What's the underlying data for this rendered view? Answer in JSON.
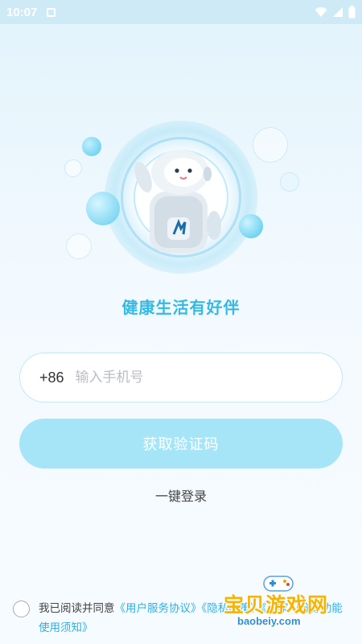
{
  "status_bar": {
    "time": "10:07",
    "icons": [
      "notification-icon",
      "wifi-icon",
      "signal-icon",
      "battery-icon"
    ]
  },
  "login": {
    "slogan": "健康生活有好伴",
    "country_code": "+86",
    "phone_placeholder": "输入手机号",
    "get_code_label": "获取验证码",
    "one_click_label": "一键登录"
  },
  "agreement": {
    "prefix": "我已阅读并同意",
    "user_agreement_link": "《用户服务协议》",
    "privacy_link": "《隐私政策》",
    "ai_notice_link": "《专家AI分身功能使用须知》"
  },
  "watermark": {
    "title": "宝贝游戏网",
    "domain": "baobeiy.com"
  },
  "colors": {
    "accent": "#34b9e3",
    "button_disabled": "#a6e5f7",
    "link": "#2cb1e0",
    "background_top": "#e2f3fb"
  }
}
